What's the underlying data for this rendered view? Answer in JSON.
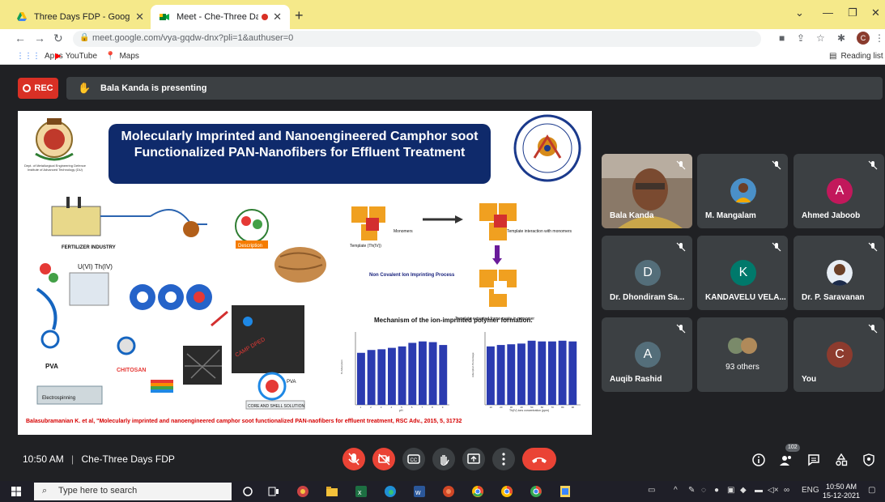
{
  "browser": {
    "tabs": [
      {
        "title": "Three Days FDP - Google Drive"
      },
      {
        "title": "Meet - Che-Three Days FDP"
      }
    ],
    "url": "meet.google.com/vya-gqdw-dnx?pli=1&authuser=0",
    "profile_initial": "C",
    "bookmarks": [
      {
        "label": "Apps"
      },
      {
        "label": "YouTube"
      },
      {
        "label": "Maps"
      }
    ],
    "reading_list": "Reading list"
  },
  "meet": {
    "rec_label": "REC",
    "presenting_text": "Bala Kanda is presenting",
    "slide": {
      "title": "Molecularly Imprinted and Nanoengineered Camphor soot Functionalized PAN-Nanofibers for Effluent Treatment",
      "logo_caption": "Dept. of Metallurgical Engineering Defence Institute of Advanced Technology (DU)",
      "labels": {
        "fertilizer": "FERTILIZER INDUSTRY",
        "uth": "U(VI) Th(IV)",
        "pva": "PVA",
        "chitosan": "CHITOSAN",
        "electrospinning": "Electrospinning",
        "camp_dped": "CAMP DPED",
        "core_shell": "CORE AND SHELL SOLUTION",
        "description": "Description",
        "monomers": "Monomers",
        "template": "Template (Th(IV))",
        "template_interaction": "Template interaction with monomers",
        "non_covalent": "Non Covalent Ion Imprinting Process",
        "template_extracted": "Template extracted forms cavity in monomer"
      },
      "mechanism_caption": "Mechanism of the ion-imprinted polymer formation.",
      "chart_left_ylabel": "% Adsorption",
      "chart_left_xlabel": "pH",
      "chart_right_ylabel": "Adsorption Percentage",
      "chart_right_xlabel": "Th(IV) ions concentration (ppm)",
      "citation": "Balasubramanian K. et al, \"Molecularly imprinted and nanoengineered camphor soot functionalized PAN-naofibers for effluent treatment, RSC Adv., 2015, 5, 31732"
    },
    "participants": [
      {
        "name": "Bala Kanda",
        "type": "video"
      },
      {
        "name": "M. Mangalam",
        "type": "photo"
      },
      {
        "name": "Ahmed Jaboob",
        "initial": "A",
        "color": "#c2185b"
      },
      {
        "name": "Dr. Dhondiram Sa...",
        "initial": "D",
        "color": "#546e7a"
      },
      {
        "name": "KANDAVELU VELA...",
        "initial": "K",
        "color": "#00796b"
      },
      {
        "name": "Dr. P. Saravanan",
        "type": "photo"
      },
      {
        "name": "Auqib Rashid",
        "initial": "A",
        "color": "#546e7a"
      },
      {
        "name": "93 others",
        "type": "others"
      },
      {
        "name": "You",
        "initial": "C",
        "color": "#8d3b2e"
      }
    ],
    "time": "10:50 AM",
    "separator": "|",
    "meeting_name": "Che-Three Days FDP",
    "participant_count": "102"
  },
  "taskbar": {
    "search_placeholder": "Type here to search",
    "lang": "ENG",
    "time": "10:50 AM",
    "date": "15-12-2021"
  },
  "chart_data": [
    {
      "type": "bar",
      "xlabel": "pH",
      "ylabel": "% Adsorption",
      "x": [
        1,
        2,
        3,
        4,
        5,
        6,
        7,
        8,
        9
      ],
      "values": [
        73,
        77,
        78,
        80,
        82,
        87,
        89,
        88,
        84
      ],
      "ylim": [
        0,
        100
      ]
    },
    {
      "type": "bar",
      "xlabel": "Th(IV) ions concentration (ppm)",
      "ylabel": "Adsorption Percentage",
      "x": [
        10,
        20,
        30,
        40,
        50,
        60,
        70,
        80,
        90
      ],
      "values": [
        82,
        84,
        85,
        86,
        90,
        89,
        89,
        90,
        89
      ],
      "ylim": [
        0,
        100
      ]
    }
  ]
}
